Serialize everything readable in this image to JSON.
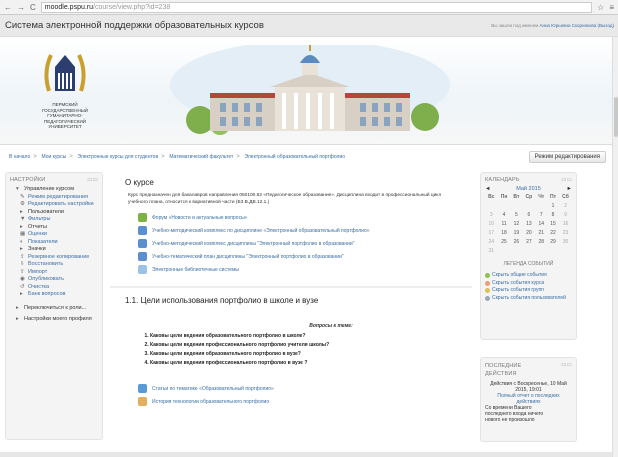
{
  "browser": {
    "url_host": "moodle.pspu.ru",
    "url_path": "/course/view.php?id=238"
  },
  "header": {
    "site_title": "Система электронной поддержки образовательных курсов",
    "login_prefix": "Вы зашли под именем",
    "user_name": "Анна Юрьевна Скорнякова",
    "logout": "(Выход)",
    "university": "ПЕРМСКИЙ ГОСУДАРСТВЕННЫЙ ГУМАНИТАРНО-ПЕДАГОГИЧЕСКИЙ УНИВЕРСИТЕТ"
  },
  "breadcrumb": [
    "В начало",
    "Мои курсы",
    "Электронные курсы для студентов",
    "Математический факультет",
    "Электронный образовательный портфолио"
  ],
  "edit_mode_button": "Режим редактирования",
  "settings": {
    "title": "НАСТРОЙКИ",
    "course_admin": "Управление курсом",
    "items": [
      {
        "label": "Режим редактирования",
        "link": true,
        "icon": "pencil-icon"
      },
      {
        "label": "Редактировать настройки",
        "link": true,
        "icon": "gear-icon"
      },
      {
        "label": "Пользователи",
        "link": false,
        "icon": "expand-icon"
      },
      {
        "label": "Фильтры",
        "link": true,
        "icon": "filter-icon"
      },
      {
        "label": "Отчеты",
        "link": false,
        "icon": "expand-icon"
      },
      {
        "label": "Оценки",
        "link": true,
        "icon": "grades-icon"
      },
      {
        "label": "Показатели",
        "link": true,
        "icon": "outcomes-icon"
      },
      {
        "label": "Значки",
        "link": false,
        "icon": "expand-icon"
      },
      {
        "label": "Резервное копирование",
        "link": true,
        "icon": "backup-icon"
      },
      {
        "label": "Восстановить",
        "link": true,
        "icon": "restore-icon"
      },
      {
        "label": "Импорт",
        "link": true,
        "icon": "import-icon"
      },
      {
        "label": "Опубликовать",
        "link": true,
        "icon": "publish-icon"
      },
      {
        "label": "Очистка",
        "link": true,
        "icon": "reset-icon"
      },
      {
        "label": "Банк вопросов",
        "link": true,
        "icon": "expand-icon"
      }
    ],
    "switch_role": "Переключиться к роли...",
    "profile": "Настройки моего профиля"
  },
  "main": {
    "about_title": "О курсе",
    "description": "Курс предназначен для бакалавров направления 050100.62 «Педагогическое образование». Дисциплина входит в профессиональный цикл учебного плана, относится к вариативной части (Б3.В.ДВ.12.1.)",
    "activities": [
      {
        "label": "Форум «Новости и актуальные вопросы»",
        "icon": "forum-icon",
        "color": "#7cb342"
      },
      {
        "label": "Учебно-методический комплекс по дисциплине «Электронный образовательный портфолио»",
        "icon": "file-icon",
        "color": "#5b8fd0"
      },
      {
        "label": "Учебно-методический комплекс дисциплины \"Электронный портфолио в образовании\"",
        "icon": "file-icon",
        "color": "#5b8fd0"
      },
      {
        "label": "Учебно-тематический план дисциплины \"Электронный портфолио в образовании\"",
        "icon": "file-icon",
        "color": "#5b8fd0"
      },
      {
        "label": "Электронные библиотечные системы",
        "icon": "page-icon",
        "color": "#9cc3e6"
      }
    ],
    "section_title": "1.1. Цели использования портфолио в школе и вузе",
    "questions_title": "Вопросы к теме:",
    "questions": [
      "Каковы цели ведения образовательного портфолио в школе?",
      "Каковы цели ведения профессионального портфолио учителя школы?",
      "Каковы цели ведения образовательного портфолио в вузе?",
      "Каковы цели ведения профессионального портфолио в вузе ?"
    ],
    "resources": [
      {
        "label": "Статьи по тематике «Образовательный портфолио»",
        "icon": "folder-icon",
        "color": "#5b9bd5"
      },
      {
        "label": "История технологии образовательного портфолио",
        "icon": "wiki-icon",
        "color": "#e0b060"
      }
    ]
  },
  "calendar": {
    "title": "КАЛЕНДАРЬ",
    "month": "Май 2015",
    "prev": "◄",
    "next": "►",
    "weekdays": [
      "Вс",
      "Пн",
      "Вт",
      "Ср",
      "Чт",
      "Пт",
      "Сб"
    ],
    "weeks": [
      [
        "",
        "",
        "",
        "",
        "",
        "1",
        "2"
      ],
      [
        "3",
        "4",
        "5",
        "6",
        "7",
        "8",
        "9"
      ],
      [
        "10",
        "11",
        "12",
        "13",
        "14",
        "15",
        "16"
      ],
      [
        "17",
        "18",
        "19",
        "20",
        "21",
        "22",
        "23"
      ],
      [
        "24",
        "25",
        "26",
        "27",
        "28",
        "29",
        "30"
      ],
      [
        "31",
        "",
        "",
        "",
        "",
        "",
        ""
      ]
    ],
    "legend_title": "ЛЕГЕНДА СОБЫТИЙ",
    "legend": [
      {
        "label": "Скрыть общие события",
        "color": "#8bc34a"
      },
      {
        "label": "Скрыть события курса",
        "color": "#e8a070"
      },
      {
        "label": "Скрыть события групп",
        "color": "#e0c050"
      },
      {
        "label": "Скрыть события пользователей",
        "color": "#9aa8b8"
      }
    ]
  },
  "recent": {
    "title": "ПОСЛЕДНИЕ ДЕЙСТВИЯ",
    "since": "Действия с Воскресенье, 10 Май 2015, 19:01",
    "full_report": "Полный отчет о последних действиях",
    "nothing": "Со времени Вашего последнего входа ничего нового не произошло"
  }
}
